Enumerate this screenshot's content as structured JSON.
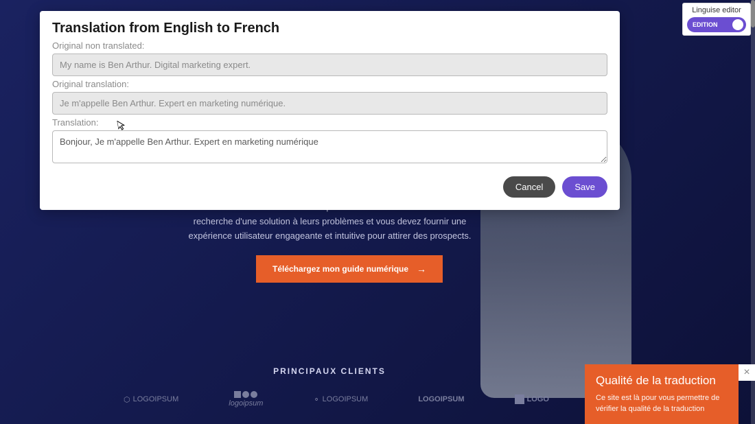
{
  "modal": {
    "title": "Translation from English to French",
    "fields": {
      "original": {
        "label": "Original non translated:",
        "value": "My name is Ben Arthur. Digital marketing expert."
      },
      "original_translation": {
        "label": "Original translation:",
        "value": "Je m'appelle Ben Arthur. Expert en marketing numérique."
      },
      "translation": {
        "label": "Translation:",
        "value": "Bonjour, Je m'appelle Ben Arthur. Expert en marketing numérique"
      }
    },
    "actions": {
      "cancel": "Cancel",
      "save": "Save"
    }
  },
  "editor_panel": {
    "title": "Linguise editor",
    "toggle_label": "EDITION"
  },
  "page": {
    "paragraph": "besoins de vos visiteurs et clients potentiels. Ils sont sur votre site à la recherche d'une solution à leurs problèmes et vous devez fournir une expérience utilisateur engageante et intuitive pour attirer des prospects.",
    "cta": "Téléchargez mon guide numérique",
    "clients_heading": "PRINCIPAUX CLIENTS",
    "logos": {
      "logo1": "LOGOIPSUM",
      "logo2": "logoipsum",
      "logo3": "LOGOIPSUM",
      "logo4": "LOGOIPSUM",
      "logo5": "LOGO"
    }
  },
  "quality_popup": {
    "title": "Qualité de la traduction",
    "text": "Ce site est là pour vous permettre de vérifier la qualité de la traduction"
  }
}
